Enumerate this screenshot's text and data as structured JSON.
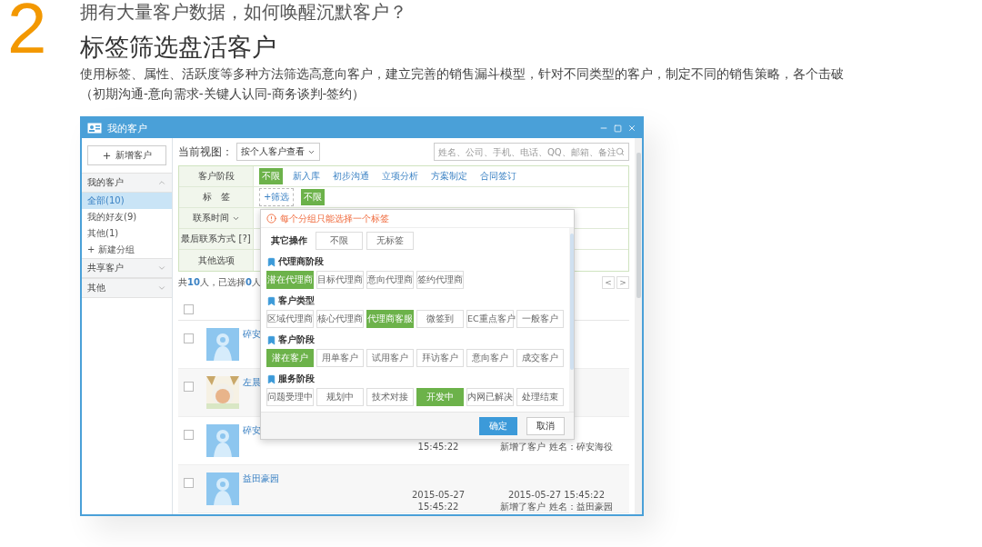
{
  "heading": {
    "number": "2",
    "question": "拥有大量客户数据，如何唤醒沉默客户？",
    "title": "标签筛选盘活客户",
    "description": "使用标签、属性、活跃度等多种方法筛选高意向客户，建立完善的销售漏斗模型，针对不同类型的客户，制定不同的销售策略，各个击破",
    "note": "（初期沟通-意向需求-关键人认同-商务谈判-签约）"
  },
  "window": {
    "title": "我的客户"
  },
  "sidebar": {
    "new_button": "新增客户",
    "groups": [
      {
        "label": "我的客户",
        "expanded": true,
        "items": [
          {
            "label": "全部(10)",
            "selected": true
          },
          {
            "label": "我的好友(9)",
            "selected": false
          },
          {
            "label": "其他(1)",
            "selected": false
          }
        ],
        "add_item": "+ 新建分组"
      },
      {
        "label": "共享客户",
        "expanded": false
      },
      {
        "label": "其他",
        "expanded": false
      }
    ]
  },
  "toolbar": {
    "view_label": "当前视图：",
    "view_select": "按个人客户查看",
    "search": {
      "placeholder": "姓名、公司、手机、电话、QQ、邮箱、备注"
    }
  },
  "filters": [
    {
      "label": "客户阶段",
      "kind": "options",
      "options": [
        {
          "label": "不限",
          "selected": true
        },
        {
          "label": "新入库",
          "selected": false
        },
        {
          "label": "初步沟通",
          "selected": false
        },
        {
          "label": "立项分析",
          "selected": false
        },
        {
          "label": "方案制定",
          "selected": false
        },
        {
          "label": "合同签订",
          "selected": false
        }
      ]
    },
    {
      "label": "标　签",
      "kind": "tags",
      "add": "+筛选",
      "options": [
        {
          "label": "不限",
          "selected": true
        }
      ]
    },
    {
      "label": "联系时间",
      "kind": "dropdown"
    },
    {
      "label": "最后联系方式 [?]",
      "kind": "plain"
    },
    {
      "label": "其他选项",
      "kind": "plain"
    }
  ],
  "summary": "共**10**人，已选择**0**人",
  "pager": {
    "prev": "<",
    "next": ">"
  },
  "header_checkbox": {
    "checked": false
  },
  "rows": [
    {
      "kind": "default",
      "checked": false,
      "name": "碎安"
    },
    {
      "kind": "picture",
      "checked": false,
      "name": "左晨"
    },
    {
      "kind": "default",
      "checked": false,
      "name": "碎安",
      "time": "15:45:22",
      "activity": "新增了客户 姓名：碎安海役"
    },
    {
      "kind": "default",
      "checked": false,
      "name": "益田豪园",
      "date": "2015-05-27",
      "time": "15:45:22",
      "activity_time": "2015-05-27 15:45:22",
      "activity": "新增了客户 姓名：益田豪园"
    }
  ],
  "tag_popup": {
    "warning": "每个分组只能选择一个标签",
    "other": {
      "label": "其它操作",
      "options": [
        "不限",
        "无标签"
      ]
    },
    "groups": [
      {
        "title": "代理商阶段",
        "tags": [
          {
            "label": "潜在代理商",
            "selected": true
          },
          {
            "label": "目标代理商",
            "selected": false
          },
          {
            "label": "意向代理商",
            "selected": false
          },
          {
            "label": "签约代理商",
            "selected": false
          }
        ]
      },
      {
        "title": "客户类型",
        "tags": [
          {
            "label": "区域代理商",
            "selected": false
          },
          {
            "label": "核心代理商",
            "selected": false
          },
          {
            "label": "代理商客服",
            "selected": true
          },
          {
            "label": "微签到",
            "selected": false
          },
          {
            "label": "EC重点客户",
            "selected": false
          },
          {
            "label": "一般客户",
            "selected": false
          }
        ]
      },
      {
        "title": "客户阶段",
        "tags": [
          {
            "label": "潜在客户",
            "selected": true
          },
          {
            "label": "用单客户",
            "selected": false
          },
          {
            "label": "试用客户",
            "selected": false
          },
          {
            "label": "拜访客户",
            "selected": false
          },
          {
            "label": "意向客户",
            "selected": false
          },
          {
            "label": "成交客户",
            "selected": false
          }
        ]
      },
      {
        "title": "服务阶段",
        "tags": [
          {
            "label": "问题受理中",
            "selected": false
          },
          {
            "label": "规划中",
            "selected": false
          },
          {
            "label": "技术对接",
            "selected": false
          },
          {
            "label": "开发中",
            "selected": true
          },
          {
            "label": "内网已解决",
            "selected": false
          },
          {
            "label": "处理结束",
            "selected": false
          }
        ]
      }
    ],
    "confirm": "确定",
    "cancel": "取消"
  }
}
